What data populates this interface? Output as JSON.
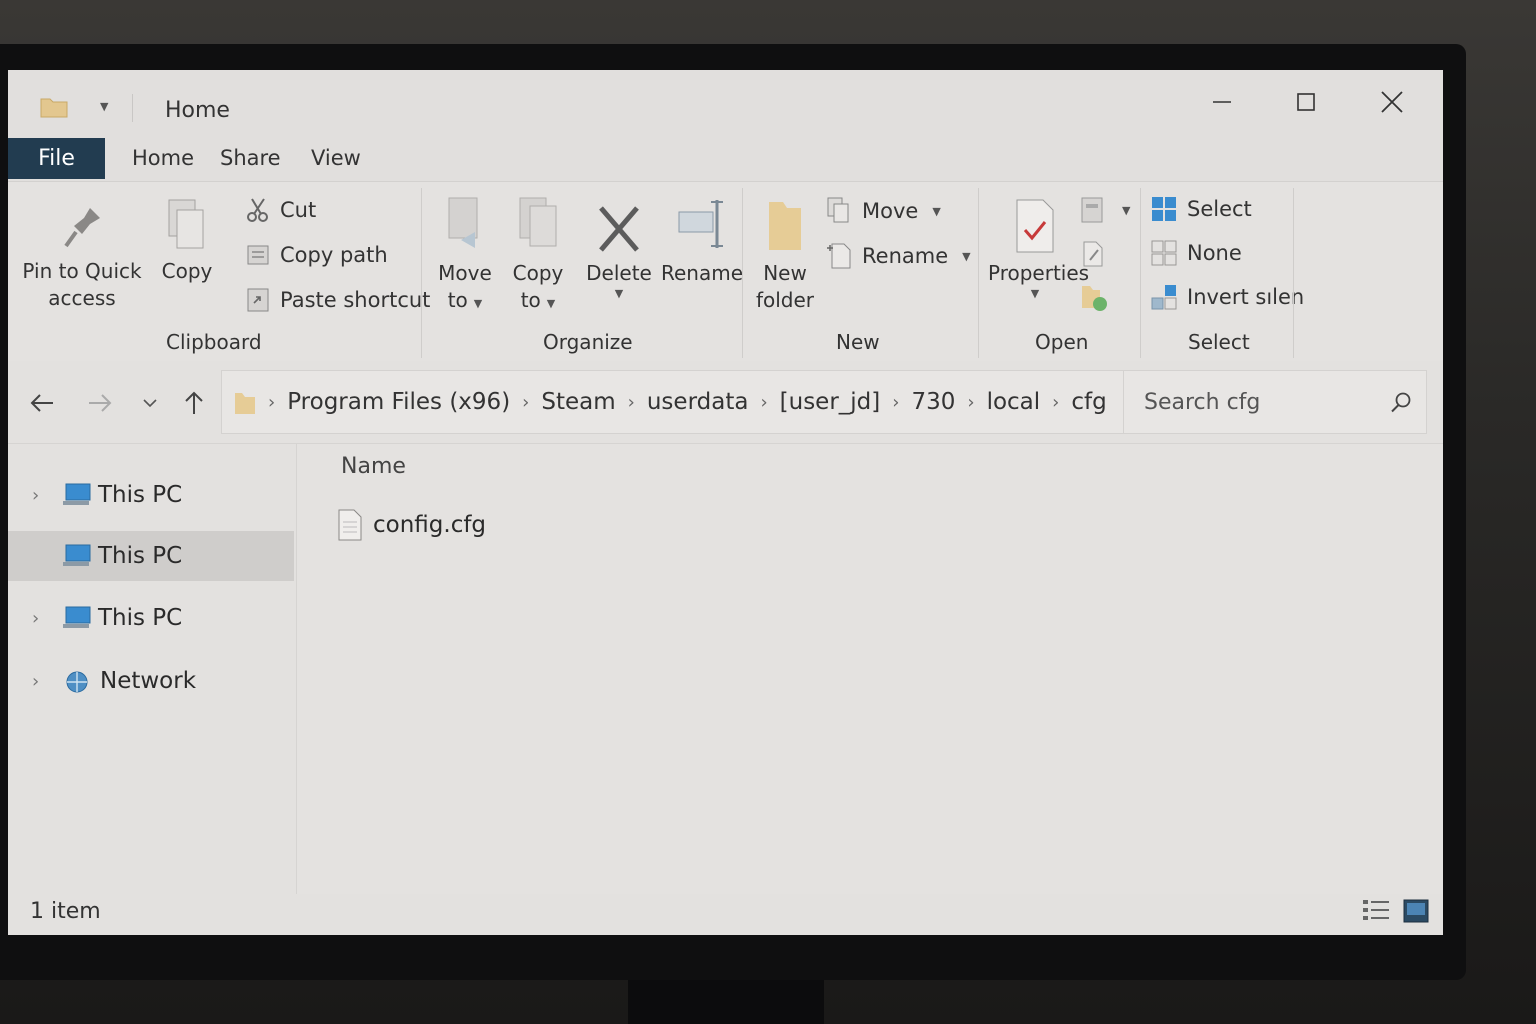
{
  "window": {
    "title": "Home",
    "tabs": {
      "file": "File",
      "home": "Home",
      "share": "Share",
      "view": "View"
    }
  },
  "ribbon": {
    "clipboard": {
      "pin_line1": "Pin to Quick",
      "pin_line2": "access",
      "copy": "Copy",
      "cut": "Cut",
      "copy_path": "Copy path",
      "paste_shortcut": "Paste shortcut",
      "label": "Clipboard"
    },
    "organize": {
      "move_to_line1": "Move",
      "move_to_line2": "to",
      "copy_to_line1": "Copy",
      "copy_to_line2": "to",
      "delete": "Delete",
      "rename": "Rename",
      "label": "Organize"
    },
    "new": {
      "new_folder_line1": "New",
      "new_folder_line2": "folder",
      "move": "Move",
      "rename": "Rename",
      "label": "New"
    },
    "open": {
      "properties": "Properties",
      "label": "Open"
    },
    "select": {
      "select_all": "Select",
      "select_none": "None",
      "invert": "Invert sılen",
      "label": "Select"
    }
  },
  "nav": {
    "breadcrumb": [
      "Program Files (x96)",
      "Steam",
      "userdata",
      "[user_jd]",
      "730",
      "local",
      "cfg"
    ],
    "search_placeholder": "Search cfg"
  },
  "sidebar": {
    "items": [
      {
        "label": "This PC"
      },
      {
        "label": "This PC"
      },
      {
        "label": "This PC"
      },
      {
        "label": "Network"
      }
    ]
  },
  "content": {
    "column_name": "Name",
    "files": [
      {
        "name": "config.cfg"
      }
    ]
  },
  "status": {
    "count": "1 item"
  },
  "colors": {
    "file_tab": "#223c50",
    "folder": "#e3c78f",
    "accent": "#3a8ccf"
  }
}
